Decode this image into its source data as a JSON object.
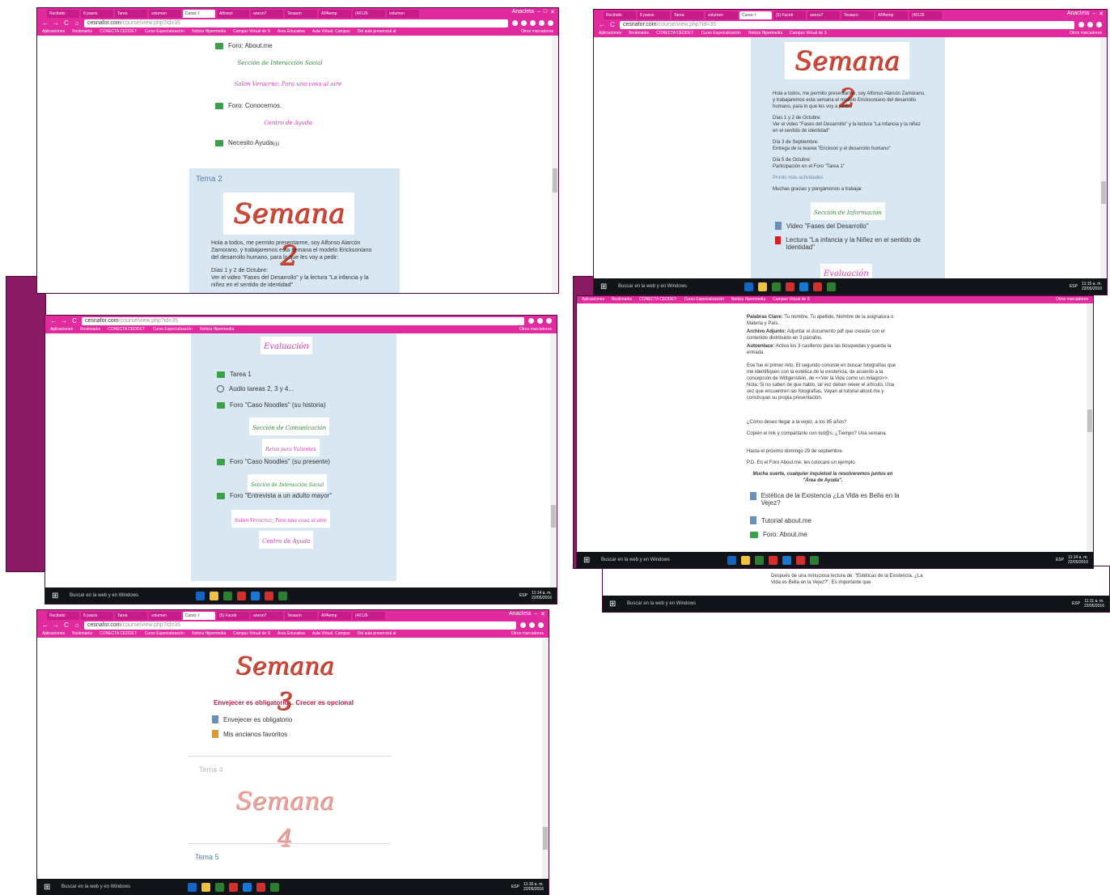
{
  "browser": {
    "tabs": [
      "Recibido:",
      "8 pasos",
      "Tarea",
      "volumen",
      "Curso: I",
      "Alfonso",
      "anexo7",
      "Tesauro",
      "APAemp",
      "(40126",
      "volumen"
    ],
    "tabs_alt": [
      "Recibido:",
      "8 pasos",
      "Tarea",
      "volumen",
      "Curso: I",
      "(5) Faceb",
      "anexo7",
      "Tesauro",
      "APAemp",
      "(40126",
      "volumen"
    ],
    "user": "Anacleta",
    "url_host": "cesnafor.com",
    "url_path": "/course/view.php?id=35",
    "bookmarks": [
      "Aplicaciones",
      "Bookmarks",
      "CONECTA CEDDET:",
      "Curso Especialización",
      "Noticia Hipermedia",
      "Campus Virtual de S",
      "Area Educativa",
      "Aula Virtual. Campus",
      "Del aula presencial al"
    ],
    "other_bookmarks": "Otros marcadores"
  },
  "taskbar": {
    "search_placeholder": "Buscar en la web y en Windows",
    "lang": "ESP",
    "date": "22/05/2016",
    "times": [
      "11:14 a. m.",
      "11:15 a. m.",
      "11:14 a. m.",
      "11:14 a. m.",
      "11:11 a. m.",
      "11:16 a. m."
    ]
  },
  "shot1": {
    "forum_about": "Foro: About.me",
    "sec_social": "Sección de Interacción Social",
    "salon": "Salón Veracruz; Para una cosa al aire",
    "forum_conocernos": "Foro: Conocernos.",
    "centro_ayuda": "Centro de Ayuda",
    "necesito": "Necesito Ayuda¡¡¡",
    "tema": "Tema 2",
    "banner": "Semana 2",
    "intro": "Hola a todos, me permito presentarme, soy Alfonso Alarcón Zamorano, y trabajaremos esta semana el modelo Ericksoniano del desarrollo humano, para lo que les voy a pedir:",
    "dias": "Días 1 y 2 de Octubre:",
    "dias_text": "Ver el video \"Fases del Desarrollo\" y la lectura \"La infancia y la niñez en el sentido de identidad\""
  },
  "shot2": {
    "banner": "Semana 2",
    "intro": "Hola a todos, me permito presentarme, soy Alfonso Alarcón Zamorano, y trabajaremos esta semana el modelo Ericksoniano del desarrollo humano, para lo que les voy a pedir:",
    "d1": "Días 1 y 2 de Octubre:",
    "d1_text": "Ver el video \"Fases del Desarrollo\" y la lectura \"La infancia y la niñez en el sentido de identidad\"",
    "d3": "Día 3 de Septiembre:",
    "d3_text": "Entrega de la tearea \"Erickson y el desarrollo humano\"",
    "d5": "Día 5 de Octubre:",
    "d5_text": "Participación en el Foro \"Tarea 1\"",
    "pronto": "Pronto más actividades",
    "gracias": "Muchas gracias y pongámonos a trabajar.",
    "sec_info": "Sección de Información",
    "video": "Video \"Fases del Desarrollo\"",
    "lectura": "Lectura \"La infancia y la Niñez en el sentido de Identidad\"",
    "evaluacion": "Evaluación"
  },
  "shot3": {
    "evaluacion": "Evaluación",
    "tarea1": "Tarea 1",
    "audio": "Audio tareas 2, 3 y 4...",
    "noodles1": "Foro \"Caso Noodles\" (su historia)",
    "sec_com": "Sección de Comunicación",
    "retos": "Retos para Valientes",
    "noodles2": "Foro \"Caso Noodles\" (su presente)",
    "sec_social": "Sección de Interacción Social",
    "entrevista": "Foro \"Entrevista a un adulto mayor\"",
    "salon": "Salón Veracruz; Para una cosa al aire",
    "centro": "Centro de Ayuda"
  },
  "shot4": {
    "palabras_label": "Palabras Clave:",
    "palabras_text": "Tu nombre, Tu apellido, Nombre de la asignatura o Materia y País.",
    "archivo_label": "Archivo Adjunto:",
    "archivo_text": "Adjuntar el documento pdf que creaste con el contenido distribuido en 3 párrafos.",
    "auto_label": "Autoenlace:",
    "auto_text": "Activa los 3 casilleros para las búsquedas y guarda la entrada.",
    "reto": "Ese fue el primer reto. El segundo consiste en buscar fotografías que me identifiquen con la estética de la existencia, de acuerdo a la concepción de Wittgenstein, de <<Ver la Vida como un milagro>>. Nota: Si no saben de que hablo, tal vez deban releer el artículo. Una vez que encuentren las fotografías, Vayan al tutorial about.me y construyan su propia presentación.",
    "pregunta": "¿Cómo deseo llegar a la vejez, a los 85 años?",
    "copien": "Copién el link y compártanlo con tod@s. ¿Tiempo? Una semana.",
    "hasta": "Hasta el próximo domingo 29 de septiembre.",
    "pd": "P.D. En el Foro About.me, les colocaré un ejemplo.",
    "suerte": "Mucha suerte, cualquier inquietud la resolveremos juntos en \"Área de Ayuda\".",
    "estetica": "Estética de la Existencia ¿La Vida es Bella en la Vejez?",
    "tutorial": "Tutorial about.me",
    "foro": "Foro: About.me",
    "behind": "Después de una minuciosa lectura de: \"Estéticas de la Existencia. ¿La Vida es Bella en la Vejez?\". Es importante que"
  },
  "shot5": {
    "banner3": "Semana 3",
    "envejecer_title": "Envejecer es obligatorio... Crecer es opcional",
    "envejecer": "Envejecer es obligatorio",
    "ancianos": "Mis ancianos favoritos",
    "tema4": "Tema 4",
    "banner4": "Semana 4",
    "tema5": "Tema 5"
  }
}
